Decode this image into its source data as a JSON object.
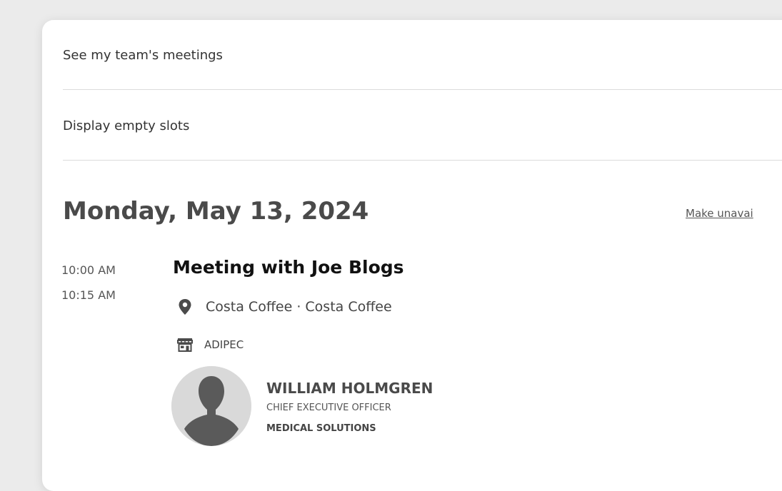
{
  "toggles": {
    "team_meetings_label": "See my team's meetings",
    "empty_slots_label": "Display empty slots"
  },
  "day": {
    "date_heading": "Monday, May 13, 2024",
    "make_unavailable_label": "Make unavai"
  },
  "meeting": {
    "start_time": "10:00 AM",
    "end_time": "10:15 AM",
    "title": "Meeting with Joe Blogs",
    "location_icon": "location-pin-icon",
    "location": "Costa Coffee · Costa Coffee",
    "event_icon": "storefront-icon",
    "event": "ADIPEC"
  },
  "attendee": {
    "avatar_icon": "person-silhouette-icon",
    "name": "WILLIAM HOLMGREN",
    "job_title": "CHIEF EXECUTIVE OFFICER",
    "company": "MEDICAL SOLUTIONS"
  },
  "colors": {
    "background": "#ebebeb",
    "card": "#ffffff",
    "heading": "#4a4a4a",
    "title": "#111111",
    "divider": "#dcdcdc"
  }
}
